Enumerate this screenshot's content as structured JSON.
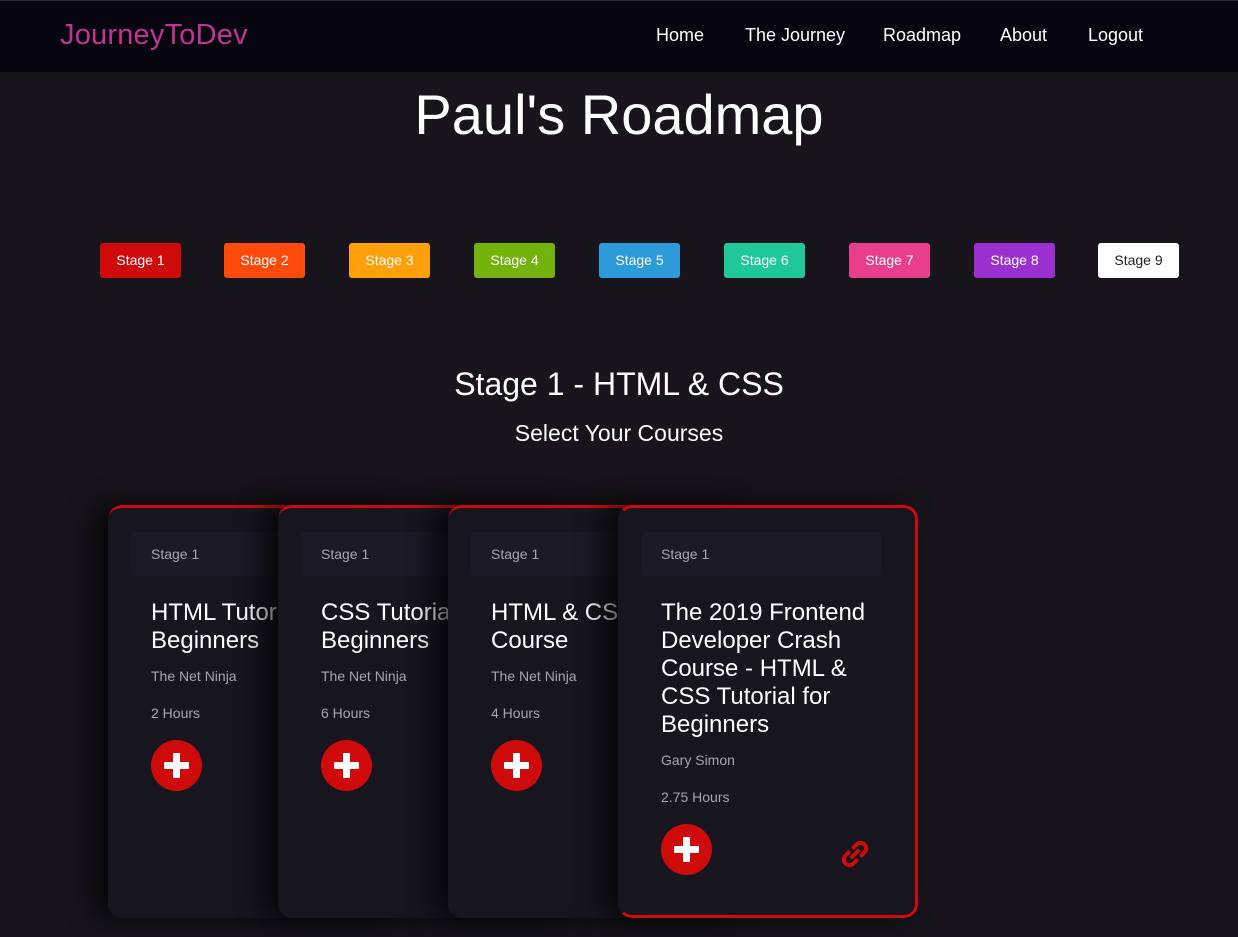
{
  "nav": {
    "brand": "JourneyToDev",
    "links": [
      "Home",
      "The Journey",
      "Roadmap",
      "About",
      "Logout"
    ]
  },
  "page": {
    "title": "Paul's Roadmap"
  },
  "stages": [
    {
      "label": "Stage 1",
      "color": "#cf0a0a",
      "text_color": "#ffffff"
    },
    {
      "label": "Stage 2",
      "color": "#ff4a0e",
      "text_color": "#ffffff"
    },
    {
      "label": "Stage 3",
      "color": "#ff9f0a",
      "text_color": "#ffffff"
    },
    {
      "label": "Stage 4",
      "color": "#74b20c",
      "text_color": "#ffffff"
    },
    {
      "label": "Stage 5",
      "color": "#2d9bd9",
      "text_color": "#ffffff"
    },
    {
      "label": "Stage 6",
      "color": "#1fc79a",
      "text_color": "#ffffff"
    },
    {
      "label": "Stage 7",
      "color": "#e83e8c",
      "text_color": "#ffffff"
    },
    {
      "label": "Stage 8",
      "color": "#9b30d0",
      "text_color": "#ffffff"
    },
    {
      "label": "Stage 9",
      "color": "#ffffff",
      "text_color": "#222222"
    }
  ],
  "section": {
    "title": "Stage 1 - HTML & CSS",
    "subtitle": "Select Your Courses"
  },
  "cards": [
    {
      "stage": "Stage 1",
      "title": "HTML Tutorial for Beginners",
      "author": "The Net Ninja",
      "hours": "2 Hours"
    },
    {
      "stage": "Stage 1",
      "title": "CSS Tutorial for Beginners",
      "author": "The Net Ninja",
      "hours": "6 Hours"
    },
    {
      "stage": "Stage 1",
      "title": "HTML & CSS Crash Course",
      "author": "The Net Ninja",
      "hours": "4 Hours"
    },
    {
      "stage": "Stage 1",
      "title": "The 2019 Frontend Developer Crash Course - HTML & CSS Tutorial for Beginners",
      "author": "Gary Simon",
      "hours": "2.75 Hours"
    }
  ],
  "icons": {
    "add": "plus-circle-icon",
    "link": "link-icon"
  },
  "colors": {
    "accent": "#cf0a0a",
    "brand": "#c2358f",
    "navbar_bg": "#06040f",
    "page_bg": "#17151b"
  }
}
